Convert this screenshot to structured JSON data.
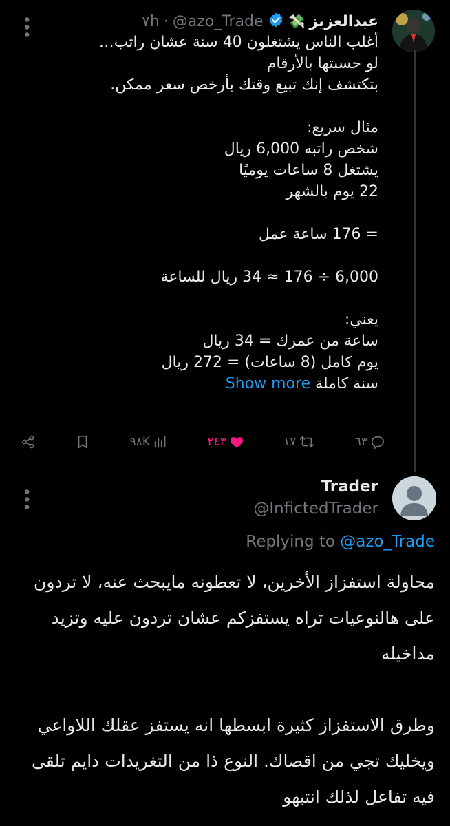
{
  "tweet1": {
    "display_name": "عبدالعزيز",
    "emoji_badge": "💸",
    "verified_icon": "verified-badge",
    "handle": "@azo_Trade",
    "time": "٧h",
    "separator": "·",
    "body": "أغلب الناس يشتغلون 40 سنة عشان راتب…\nلو حسبتها بالأرقام\nبتكتشف إنك تبيع وقتك بأرخص سعر ممكن.\n\nمثال سريع:\nشخص راتبه 6,000 ريال\nيشتغل 8 ساعات يوميًا\n22 يوم بالشهر\n\n= 176 ساعة عمل\n\n6,000 ÷ 176 ≈ 34 ريال للساعة\n\nيعني:\nساعة من عمرك = 34 ريال\nيوم كامل (8 ساعات) = 272 ريال\nسنة كاملة",
    "show_more": "Show more",
    "actions": {
      "replies": "٦٣",
      "retweets": "١٧",
      "likes": "٢٤٣",
      "views": "٩٨K"
    }
  },
  "tweet2": {
    "display_name": "Trader",
    "handle": "@InfictedTrader",
    "replying_prefix": "Replying to",
    "replying_handle": "@azo_Trade",
    "body": "محاولة استفزاز الأخرين، لا تعطونه مايبحث عنه، لا تردون على هالنوعيات تراه يستفزكم عشان تردون عليه وتزيد مداخيله\n\nوطرق الاستفزاز كثيرة ابسطها انه يستفز عقلك اللاواعي ويخليك تجي من اقصاك. النوع ذا من التغريدات دايم تلقى فيه تفاعل لذلك انتبهو"
  },
  "colors": {
    "background": "#000000",
    "text": "#e7e9ea",
    "secondary": "#71767b",
    "link": "#1d9bf0",
    "like": "#f91880"
  }
}
